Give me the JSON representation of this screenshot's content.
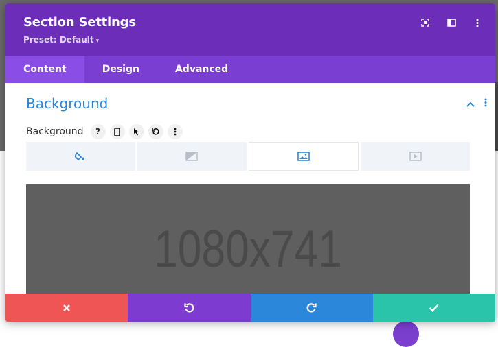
{
  "colors": {
    "header": "#6c2eb9",
    "tabs": "#7b3ed3",
    "active_tab": "#8a4ee6",
    "section_title": "#2b87da",
    "discard": "#ef5555",
    "undo": "#7e3bd0",
    "redo": "#2b87da",
    "save": "#29c4a9"
  },
  "header": {
    "title": "Section Settings",
    "preset": "Preset: Default",
    "icons": [
      "fullscreen-icon",
      "sidebar-layout-icon",
      "more-vertical-icon"
    ]
  },
  "tabs": [
    {
      "label": "Content",
      "active": true
    },
    {
      "label": "Design",
      "active": false
    },
    {
      "label": "Advanced",
      "active": false
    }
  ],
  "section": {
    "title": "Background",
    "field_label": "Background",
    "field_tools": [
      "help-icon",
      "mobile-icon",
      "cursor-icon",
      "reset-icon",
      "more-icon"
    ],
    "bg_types": [
      {
        "icon": "paint-bucket-icon",
        "active": false
      },
      {
        "icon": "gradient-icon",
        "active": false
      },
      {
        "icon": "image-icon",
        "active": true
      },
      {
        "icon": "video-icon",
        "active": false
      }
    ],
    "image_placeholder": "1080x741"
  },
  "footer": {
    "buttons": [
      "discard",
      "undo",
      "redo",
      "save"
    ]
  }
}
